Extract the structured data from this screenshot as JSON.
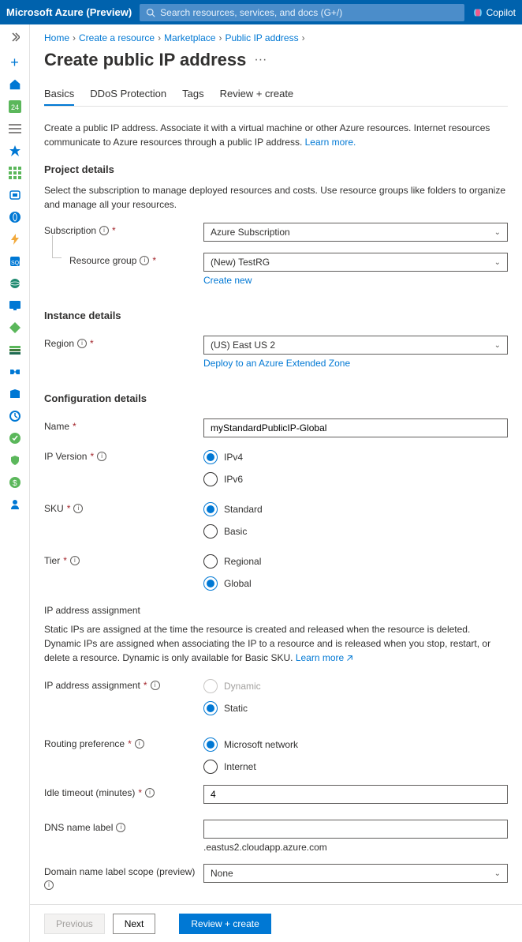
{
  "topbar": {
    "brand": "Microsoft Azure (Preview)",
    "search_placeholder": "Search resources, services, and docs (G+/)",
    "copilot": "Copilot"
  },
  "breadcrumbs": [
    "Home",
    "Create a resource",
    "Marketplace",
    "Public IP address"
  ],
  "page_title": "Create public IP address",
  "tabs": [
    "Basics",
    "DDoS Protection",
    "Tags",
    "Review + create"
  ],
  "active_tab": 0,
  "intro": {
    "text": "Create a public IP address. Associate it with a virtual machine or other Azure resources. Internet resources communicate to Azure resources through a public IP address. ",
    "learn_more": "Learn more."
  },
  "project_details": {
    "heading": "Project details",
    "desc": "Select the subscription to manage deployed resources and costs. Use resource groups like folders to organize and manage all your resources.",
    "subscription_label": "Subscription",
    "subscription_value": "Azure Subscription",
    "rg_label": "Resource group",
    "rg_value": "(New) TestRG",
    "create_new": "Create new"
  },
  "instance": {
    "heading": "Instance details",
    "region_label": "Region",
    "region_value": "(US) East US 2",
    "extended_zone": "Deploy to an Azure Extended Zone"
  },
  "config": {
    "heading": "Configuration details",
    "name_label": "Name",
    "name_value": "myStandardPublicIP-Global",
    "ipver_label": "IP Version",
    "ipver_options": [
      "IPv4",
      "IPv6"
    ],
    "ipver_selected": "IPv4",
    "sku_label": "SKU",
    "sku_options": [
      "Standard",
      "Basic"
    ],
    "sku_selected": "Standard",
    "tier_label": "Tier",
    "tier_options": [
      "Regional",
      "Global"
    ],
    "tier_selected": "Global",
    "ip_assign_heading": "IP address assignment",
    "ip_assign_desc": "Static IPs are assigned at the time the resource is created and released when the resource is deleted. Dynamic IPs are assigned when associating the IP to a resource and is released when you stop, restart, or delete a resource. Dynamic is only available for Basic SKU. ",
    "ip_assign_learn": "Learn more",
    "ip_assign_label": "IP address assignment",
    "ip_assign_options": [
      "Dynamic",
      "Static"
    ],
    "ip_assign_disabled": "Dynamic",
    "ip_assign_selected": "Static",
    "routing_label": "Routing preference",
    "routing_options": [
      "Microsoft network",
      "Internet"
    ],
    "routing_selected": "Microsoft network",
    "idle_label": "Idle timeout (minutes)",
    "idle_value": "4",
    "dns_label": "DNS name label",
    "dns_value": "",
    "dns_suffix": ".eastus2.cloudapp.azure.com",
    "domain_scope_label": "Domain name label scope (preview)",
    "domain_scope_value": "None"
  },
  "footer": {
    "previous": "Previous",
    "next": "Next",
    "review": "Review + create"
  },
  "colors": {
    "accent": "#0078d4",
    "topbar": "#0062ad"
  }
}
